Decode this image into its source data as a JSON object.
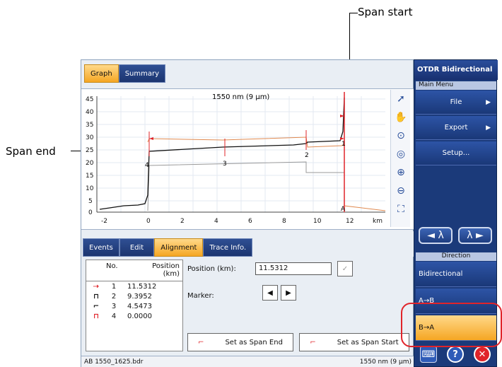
{
  "annotations": {
    "span_start": "Span start",
    "span_end": "Span end"
  },
  "graph": {
    "tabs": [
      {
        "label": "Graph",
        "active": true
      },
      {
        "label": "Summary",
        "active": false
      }
    ],
    "title": "1550 nm (9 µm)",
    "y_ticks": [
      "45",
      "40",
      "35",
      "30",
      "25",
      "20",
      "15",
      "10",
      "5",
      "0"
    ],
    "x_ticks": [
      "-2",
      "0",
      "2",
      "4",
      "6",
      "8",
      "10",
      "12"
    ],
    "x_unit": "km",
    "event_labels": [
      "1",
      "2",
      "3",
      "4",
      "A"
    ],
    "tools": [
      "pointer-icon",
      "hand-pan-icon",
      "zoom-fit-icon",
      "zoom-1to1-icon",
      "zoom-in-icon",
      "zoom-out-icon",
      "zoom-region-icon"
    ]
  },
  "lower_tabs": [
    {
      "label": "Events",
      "active": false
    },
    {
      "label": "Edit",
      "active": false
    },
    {
      "label": "Alignment",
      "active": true
    },
    {
      "label": "Trace Info.",
      "active": false
    }
  ],
  "events_table": {
    "col_no": "No.",
    "col_position": "Position",
    "col_unit": "(km)",
    "rows": [
      {
        "icon": "span-start-icon",
        "no": "1",
        "position": "11.5312"
      },
      {
        "icon": "reflective-event-icon",
        "no": "2",
        "position": "9.3952"
      },
      {
        "icon": "non-reflective-event-icon",
        "no": "3",
        "position": "4.5473"
      },
      {
        "icon": "span-end-icon",
        "no": "4",
        "position": "0.0000"
      }
    ]
  },
  "alignment": {
    "position_label": "Position (km):",
    "position_value": "11.5312",
    "marker_label": "Marker:",
    "set_span_end": "Set as Span End",
    "set_span_start": "Set as Span Start"
  },
  "statusbar": {
    "file": "AB 1550_1625.bdr",
    "wavelength": "1550 nm (9 µm)"
  },
  "right_panel": {
    "title": "OTDR Bidirectional",
    "main_menu": "Main Menu",
    "items": [
      {
        "label": "File",
        "arrow": true
      },
      {
        "label": "Export",
        "arrow": true
      },
      {
        "label": "Setup...",
        "arrow": false
      }
    ],
    "direction_label": "Direction",
    "direction_items": [
      {
        "label": "Bidirectional",
        "active": false
      },
      {
        "label": "A→B",
        "active": false
      },
      {
        "label": "B→A",
        "active": true
      }
    ],
    "lambda_prev": "◄ λ",
    "lambda_next": "λ ►",
    "bottom_icons": [
      "keyboard-icon",
      "help-icon",
      "close-icon"
    ]
  },
  "colors": {
    "accent": "#f5a623",
    "panel_blue": "#1b3a7a",
    "marker_red": "#e0242a",
    "trace_black": "#111111",
    "trace_orange": "#e08a50",
    "trace_gray": "#9a9a9a"
  }
}
